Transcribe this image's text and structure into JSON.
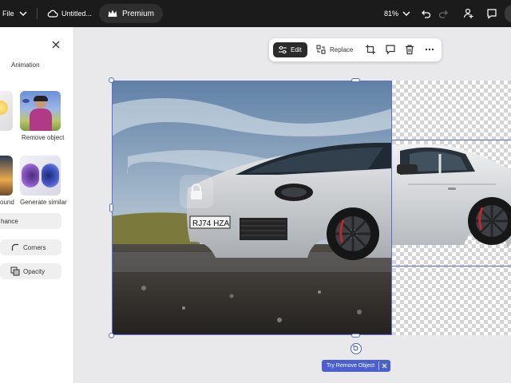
{
  "topbar": {
    "file_label": "File",
    "doc_title": "Untitled...",
    "premium_label": "Premium",
    "zoom_label": "81%",
    "icons": [
      "chevron-down-icon",
      "cloud-icon",
      "crown-icon",
      "undo-icon",
      "redo-icon",
      "share-icon",
      "comment-icon"
    ]
  },
  "panel": {
    "animation_label": "Animation",
    "remove_object_label": "Remove object",
    "background_label": "ound",
    "generate_similar_label": "Generate similar",
    "enhance_label": "hance",
    "corners_label": "Corners",
    "opacity_label": "Opacity"
  },
  "toolbar": {
    "edit_label": "Edit",
    "replace_label": "Replace"
  },
  "canvas": {
    "plate_text": "RJ74 HZA",
    "try_remove_label": "Try Remove Object",
    "accent_color": "#4a5fd0"
  }
}
